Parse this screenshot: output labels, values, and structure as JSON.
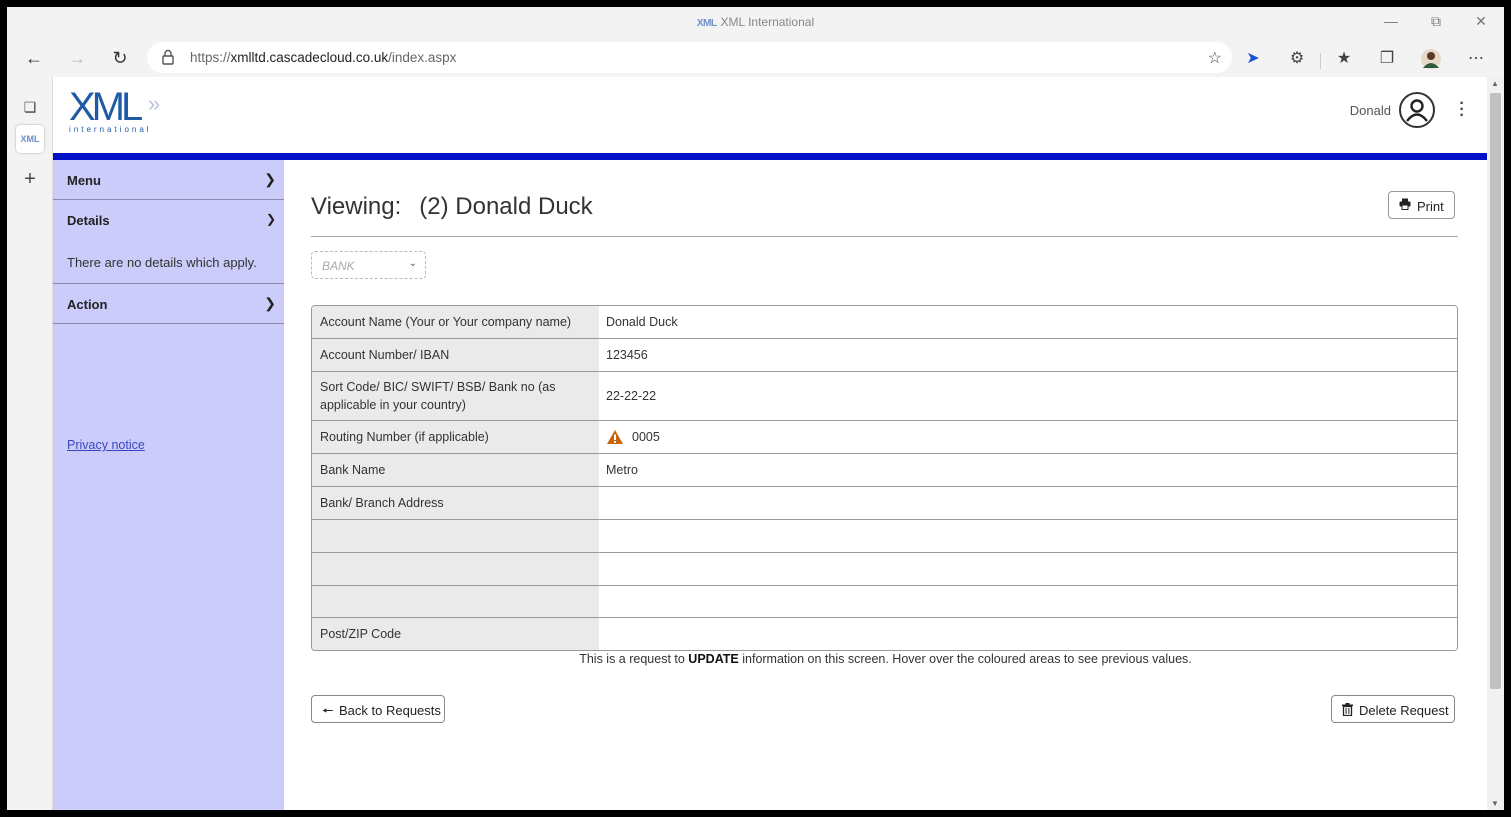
{
  "browser": {
    "window_title": "XML International",
    "url_prefix": "https://",
    "url_host": "xmlltd.cascadecloud.co.uk",
    "url_path": "/index.aspx",
    "tab_logo_text": "XML"
  },
  "header": {
    "logo_text": "XML",
    "logo_sub": "international",
    "user_name": "Donald"
  },
  "sidebar": {
    "menu_label": "Menu",
    "details_label": "Details",
    "details_text": "There are no details which apply.",
    "action_label": "Action",
    "privacy_link": "Privacy notice"
  },
  "main": {
    "heading_prefix": "Viewing:",
    "heading_name": "(2) Donald Duck",
    "print_label": "Print",
    "dropdown_value": "BANK",
    "rows": [
      {
        "label": "Account Name (Your or Your company name)",
        "value": "Donald Duck"
      },
      {
        "label": "Account Number/ IBAN",
        "value": "123456"
      },
      {
        "label": "Sort Code/ BIC/ SWIFT/ BSB/ Bank no (as applicable in your country)",
        "value": "22-22-22"
      },
      {
        "label": "Routing Number (if applicable)",
        "value": "0005"
      },
      {
        "label": "Bank Name",
        "value": "Metro"
      },
      {
        "label": "Bank/ Branch Address",
        "value": ""
      },
      {
        "label": "",
        "value": ""
      },
      {
        "label": "",
        "value": ""
      },
      {
        "label": "",
        "value": ""
      },
      {
        "label": "Post/ZIP Code",
        "value": ""
      }
    ],
    "notice_before": "This is a request to ",
    "notice_bold": "UPDATE",
    "notice_after": " information on this screen. Hover over the coloured areas to see previous values.",
    "back_label": "Back to Requests",
    "delete_label": "Delete Request"
  },
  "colors": {
    "brand_blue": "#0010c4",
    "sidebar_bg": "#ccccfa",
    "warning": "#c8650a"
  }
}
